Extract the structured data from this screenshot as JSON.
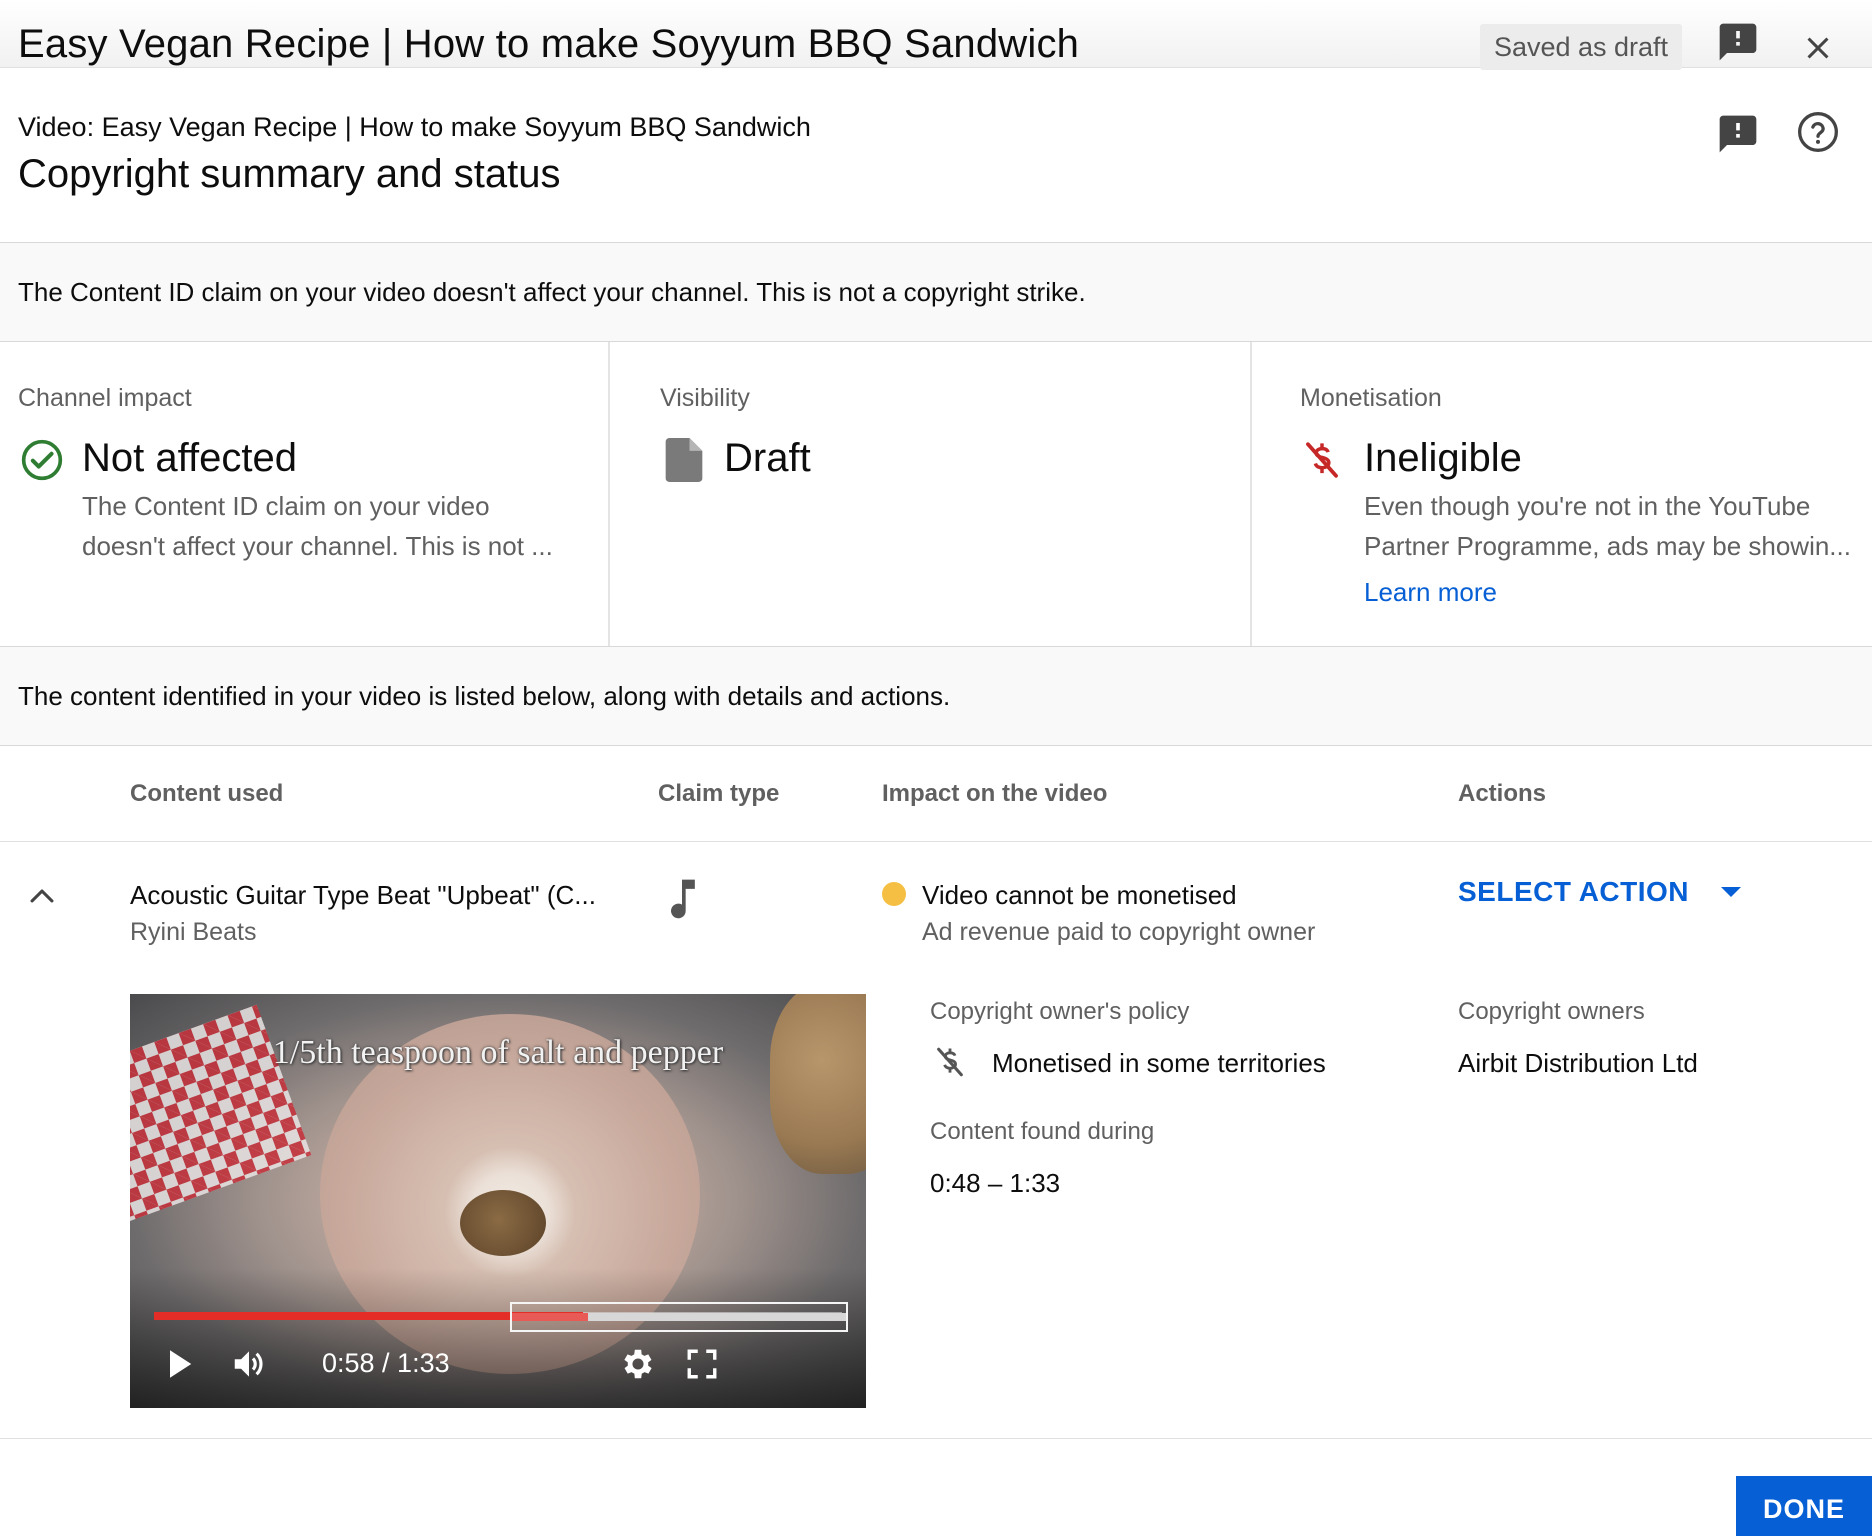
{
  "window": {
    "title": "Easy Vegan Recipe | How to make Soyyum BBQ Sandwich",
    "draft_status": "Saved as draft"
  },
  "header": {
    "subtitle": "Video: Easy Vegan Recipe | How to make Soyyum BBQ Sandwich",
    "title": "Copyright summary and status"
  },
  "notice": "The Content ID claim on your video doesn't affect your channel. This is not a copyright strike.",
  "summary": {
    "channel_impact": {
      "label": "Channel impact",
      "value": "Not affected",
      "desc_line1": "The Content ID claim on your video",
      "desc_line2": "doesn't affect your channel. This is not ..."
    },
    "visibility": {
      "label": "Visibility",
      "value": "Draft"
    },
    "monetisation": {
      "label": "Monetisation",
      "value": "Ineligible",
      "desc_line1": "Even though you're not in the YouTube",
      "desc_line2": "Partner Programme, ads may be showin...",
      "link": "Learn more"
    }
  },
  "content_notice": "The content identified in your video is listed below, along with details and actions.",
  "table": {
    "headers": {
      "content_used": "Content used",
      "claim_type": "Claim type",
      "impact": "Impact on the video",
      "actions": "Actions"
    },
    "row": {
      "content_title": "Acoustic Guitar Type Beat \"Upbeat\" (C...",
      "content_artist": "Ryini Beats",
      "claim_type_icon": "music-note-icon",
      "impact_title": "Video cannot be monetised",
      "impact_sub": "Ad revenue paid to copyright owner",
      "action_label": "SELECT ACTION"
    }
  },
  "player": {
    "caption": "1/5th teaspoon of salt and pepper",
    "time": "0:58 / 1:33",
    "played_fraction": 0.623
  },
  "details": {
    "policy_label": "Copyright owner's policy",
    "policy_value": "Monetised in some territories",
    "owners_label": "Copyright owners",
    "owners_value": "Airbit Distribution Ltd",
    "found_label": "Content found during",
    "found_value": "0:48 – 1:33"
  },
  "footer": {
    "done_label": "DONE"
  },
  "colors": {
    "accent": "#065fd4",
    "success": "#2e7d32",
    "error": "#c62828",
    "warning_dot": "#f4bf42",
    "progress": "#e52d27"
  }
}
